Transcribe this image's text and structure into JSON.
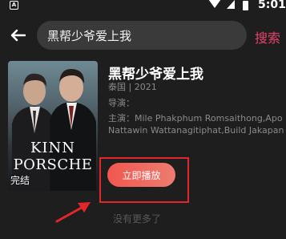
{
  "status_bar": {
    "notification_label": "A",
    "time": "5:01",
    "icons": [
      "notification-icon",
      "wifi-icon",
      "signal-icon",
      "battery-icon"
    ]
  },
  "header": {
    "search_value": "黑帮少爷爱上我",
    "search_button_label": "搜索"
  },
  "result": {
    "title": "黑帮少爷爱上我",
    "region_year": "泰国 | 2021",
    "director": "导演：",
    "cast_line1": "主演：Mile Phakphum Romsaithong,Apo",
    "cast_line2": "Nattawin Wattanagitiphat,Build Jakapan",
    "poster": {
      "title_line1": "KINN",
      "title_line2": "PORSCHE",
      "badge": "完结"
    },
    "play_button_label": "立即播放"
  },
  "footer": {
    "no_more_text": "没有更多了"
  },
  "colors": {
    "background": "#1e1e1e",
    "search_box": "#3a3a3a",
    "accent": "#e8436a",
    "play_gradient_start": "#f0574f",
    "play_gradient_end": "#ee7c70",
    "annotation_red": "#e3262a"
  }
}
